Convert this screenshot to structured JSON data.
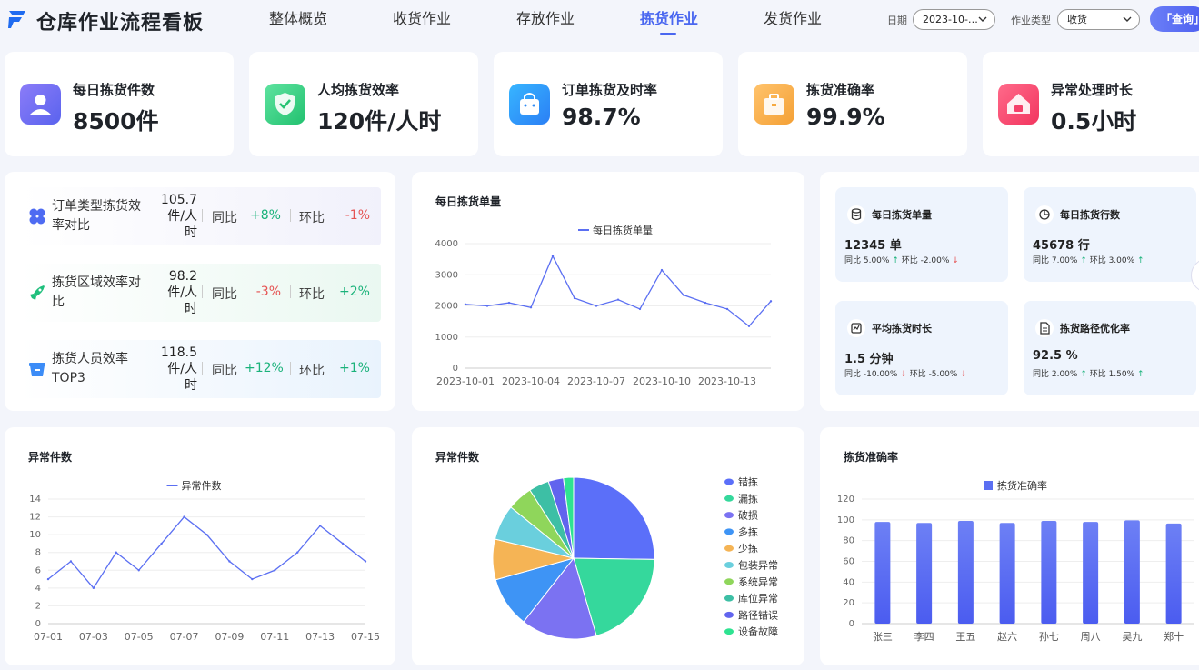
{
  "header": {
    "title": "仓库作业流程看板",
    "nav": [
      "整体概览",
      "收货作业",
      "存放作业",
      "拣货作业",
      "发货作业"
    ],
    "active_nav": 3,
    "filters": {
      "date_label": "日期",
      "date_value": "2023-10-…",
      "type_label": "作业类型",
      "type_value": "收货"
    },
    "query_label": "「查询」"
  },
  "kpis": [
    {
      "title": "每日拣货件数",
      "value": "8500件",
      "icon": "user-icon"
    },
    {
      "title": "人均拣货效率",
      "value": "120件/人时",
      "icon": "shield-check-icon"
    },
    {
      "title": "订单拣货及时率",
      "value": "98.7%",
      "icon": "bag-icon"
    },
    {
      "title": "拣货准确率",
      "value": "99.9%",
      "icon": "box-icon"
    },
    {
      "title": "异常处理时长",
      "value": "0.5小时",
      "icon": "home-icon"
    }
  ],
  "efficiency_rows": [
    {
      "name": "订单类型拣货效率对比",
      "value": "105.7件/人时",
      "yoy_label": "同比",
      "yoy": "+8%",
      "yoy_dir": "up",
      "mom_label": "环比",
      "mom": "-1%",
      "mom_dir": "down"
    },
    {
      "name": "拣货区域效率对比",
      "value": "98.2件/人时",
      "yoy_label": "同比",
      "yoy": "-3%",
      "yoy_dir": "down",
      "mom_label": "环比",
      "mom": "+2%",
      "mom_dir": "up"
    },
    {
      "name": "拣货人员效率TOP3",
      "value": "118.5件/人时",
      "yoy_label": "同比",
      "yoy": "+12%",
      "yoy_dir": "up",
      "mom_label": "环比",
      "mom": "+1%",
      "mom_dir": "up"
    }
  ],
  "mini_stats": [
    {
      "title": "每日拣货单量",
      "value": "12345 单",
      "yoy": "同比 5.00%",
      "yoy_dir": "up",
      "mom": "环比 -2.00%",
      "mom_dir": "down",
      "icon": "database-icon"
    },
    {
      "title": "每日拣货行数",
      "value": "45678 行",
      "yoy": "同比 7.00%",
      "yoy_dir": "up",
      "mom": "环比 3.00%",
      "mom_dir": "up",
      "icon": "pie-icon"
    },
    {
      "title": "平均拣货时长",
      "value": "1.5 分钟",
      "yoy": "同比 -10.00%",
      "yoy_dir": "down",
      "mom": "环比 -5.00%",
      "mom_dir": "down",
      "icon": "chart-icon"
    },
    {
      "title": "拣货路径优化率",
      "value": "92.5 %",
      "yoy": "同比 2.00%",
      "yoy_dir": "up",
      "mom": "环比 1.50%",
      "mom_dir": "up",
      "icon": "file-icon"
    }
  ],
  "colors": {
    "primary": "#5b6ff2",
    "up": "#1ab27a",
    "down": "#e55353"
  },
  "chart_data": [
    {
      "type": "line",
      "title": "每日拣货单量",
      "legend": [
        "每日拣货单量"
      ],
      "x": [
        "2023-10-01",
        "2023-10-02",
        "2023-10-03",
        "2023-10-04",
        "2023-10-05",
        "2023-10-06",
        "2023-10-07",
        "2023-10-08",
        "2023-10-09",
        "2023-10-10",
        "2023-10-11",
        "2023-10-12",
        "2023-10-13",
        "2023-10-14",
        "2023-10-15"
      ],
      "xticks": [
        "2023-10-01",
        "2023-10-04",
        "2023-10-07",
        "2023-10-10",
        "2023-10-13"
      ],
      "series": [
        {
          "name": "每日拣货单量",
          "values": [
            2050,
            2000,
            2100,
            1950,
            3600,
            2250,
            2000,
            2200,
            1900,
            3150,
            2350,
            2100,
            1900,
            1350,
            2150
          ]
        }
      ],
      "ylim": [
        0,
        4000
      ],
      "yticks": [
        0,
        1000,
        2000,
        3000,
        4000
      ]
    },
    {
      "type": "line",
      "title": "异常件数",
      "legend": [
        "异常件数"
      ],
      "x": [
        "07-01",
        "07-02",
        "07-03",
        "07-04",
        "07-05",
        "07-06",
        "07-07",
        "07-08",
        "07-09",
        "07-10",
        "07-11",
        "07-12",
        "07-13",
        "07-14",
        "07-15"
      ],
      "xticks": [
        "07-01",
        "07-03",
        "07-05",
        "07-07",
        "07-09",
        "07-11",
        "07-13",
        "07-15"
      ],
      "series": [
        {
          "name": "异常件数",
          "values": [
            5,
            7,
            4,
            8,
            6,
            9,
            12,
            10,
            7,
            5,
            6,
            8,
            11,
            9,
            7
          ]
        }
      ],
      "ylim": [
        0,
        14
      ],
      "yticks": [
        0,
        2,
        4,
        6,
        8,
        10,
        12,
        14
      ]
    },
    {
      "type": "pie",
      "title": "异常件数",
      "categories": [
        "错拣",
        "漏拣",
        "破损",
        "多拣",
        "少拣",
        "包装异常",
        "系统异常",
        "库位异常",
        "路径错误",
        "设备故障"
      ],
      "values": [
        25,
        20,
        15,
        10,
        8,
        7,
        5,
        4,
        3,
        2
      ],
      "colors": [
        "#5b6ff9",
        "#35d89c",
        "#7b72f2",
        "#3e94f5",
        "#f5b455",
        "#6acfdd",
        "#8fd65b",
        "#3dbfa5",
        "#6164ee",
        "#2ee391"
      ]
    },
    {
      "type": "bar",
      "title": "拣货准确率",
      "legend": [
        "拣货准确率"
      ],
      "categories": [
        "张三",
        "李四",
        "王五",
        "赵六",
        "孙七",
        "周八",
        "吴九",
        "郑十"
      ],
      "values": [
        98,
        97,
        99,
        97,
        99,
        98,
        99.5,
        96.5
      ],
      "ylim": [
        0,
        120
      ],
      "yticks": [
        0,
        20,
        40,
        60,
        80,
        100,
        120
      ]
    }
  ]
}
